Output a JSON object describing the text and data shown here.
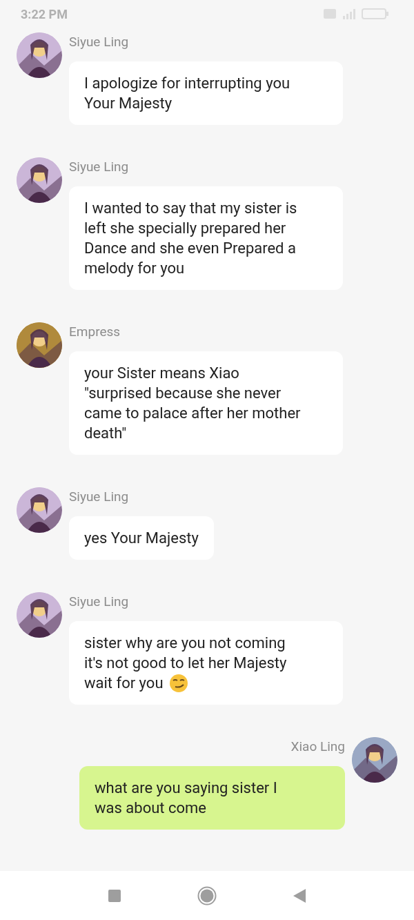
{
  "status_bar": {
    "time": "3:22 PM"
  },
  "messages": [
    {
      "kind": "incoming",
      "sender": "Siyue Ling",
      "color": "#cbb6d8",
      "lines": [
        "I apologize for interrupting you",
        "Your Majesty"
      ]
    },
    {
      "kind": "incoming",
      "sender": "Siyue Ling",
      "color": "#cbb6d8",
      "lines": [
        "I wanted to say that my sister is",
        "left she specially prepared her",
        "Dance and she even Prepared a",
        "melody for you"
      ]
    },
    {
      "kind": "incoming",
      "sender": "Empress",
      "color": "#b08a3c",
      "lines": [
        "your Sister means Xiao",
        "\"surprised because she never",
        "came to palace after her mother",
        "death\""
      ]
    },
    {
      "kind": "incoming",
      "sender": "Siyue Ling",
      "color": "#cbb6d8",
      "lines": [
        "yes Your Majesty"
      ]
    },
    {
      "kind": "incoming",
      "sender": "Siyue Ling",
      "color": "#cbb6d8",
      "lines": [
        "sister why are you not coming",
        "it's not good to let her Majesty",
        "wait for you"
      ],
      "smirk_emoji": true
    },
    {
      "kind": "outgoing",
      "sender": "Xiao Ling",
      "color": "#9aa8c4",
      "lines": [
        "what are you saying sister I",
        "was about come"
      ]
    }
  ]
}
